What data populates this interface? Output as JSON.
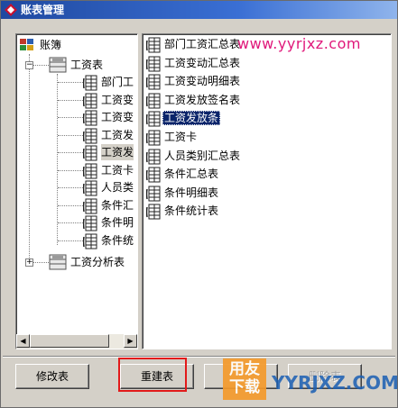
{
  "window": {
    "title": "账表管理"
  },
  "watermark": {
    "url_text": "www.yyrjxz.com",
    "logo_line1": "用友",
    "logo_line2": "下载",
    "logo_domain": "YYRJXZ.COM"
  },
  "tree": {
    "root_label": "账簿",
    "group1": {
      "label": "工资表",
      "expander": "−"
    },
    "children": [
      "部门工",
      "工资变",
      "工资变",
      "工资发",
      "工资发",
      "工资卡",
      "人员类",
      "条件汇",
      "条件明",
      "条件统"
    ],
    "group2": {
      "label": "工资分析表",
      "expander": "+"
    }
  },
  "list": {
    "items": [
      "部门工资汇总表",
      "工资变动汇总表",
      "工资变动明细表",
      "工资发放签名表",
      "工资发放条",
      "工资卡",
      "人员类别汇总表",
      "条件汇总表",
      "条件明细表",
      "条件统计表"
    ],
    "selected_index": 4
  },
  "buttons": {
    "modify": "修改表",
    "rebuild": "重建表",
    "third": "",
    "delete": "删除表"
  },
  "scroll": {
    "left_arrow": "◀",
    "right_arrow": "▶"
  },
  "colors": {
    "highlight": "#0a246a",
    "annotation_box": "#e21a1a",
    "watermark_pink": "#e0187a"
  }
}
